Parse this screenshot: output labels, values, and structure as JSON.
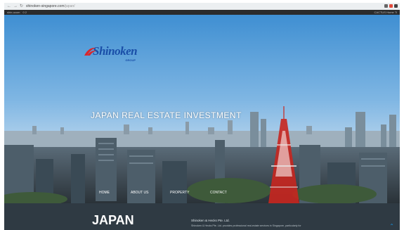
{
  "browser": {
    "url_domain": "shinoken-singapore.com",
    "url_path": "/japan/",
    "bookmark_left": "shin-ucom",
    "bookmark_mid": "0 2",
    "bookmark_right": "CACTUS Home Ti"
  },
  "logo": {
    "brand": "Shinoken",
    "group": "GROUP"
  },
  "hero": {
    "headline": "JAPAN REAL ESTATE INVESTMENT"
  },
  "nav": {
    "home": "HOME",
    "about": "ABOUT US",
    "property": "PROPERTY",
    "contact": "CONTACT"
  },
  "section": {
    "title": "JAPAN",
    "company": "Shinoken & Hecks Pte. Ltd.",
    "description": "Shinoken & Hecks Pte. Ltd. provides professional real-estate services in Singapore, particularly for"
  },
  "colors": {
    "brand_blue": "#1a4fa8",
    "logo_red": "#d9262c",
    "tower_red": "#c8261f",
    "footer_bg": "#2f3a43",
    "accent": "#1a8dd6"
  }
}
